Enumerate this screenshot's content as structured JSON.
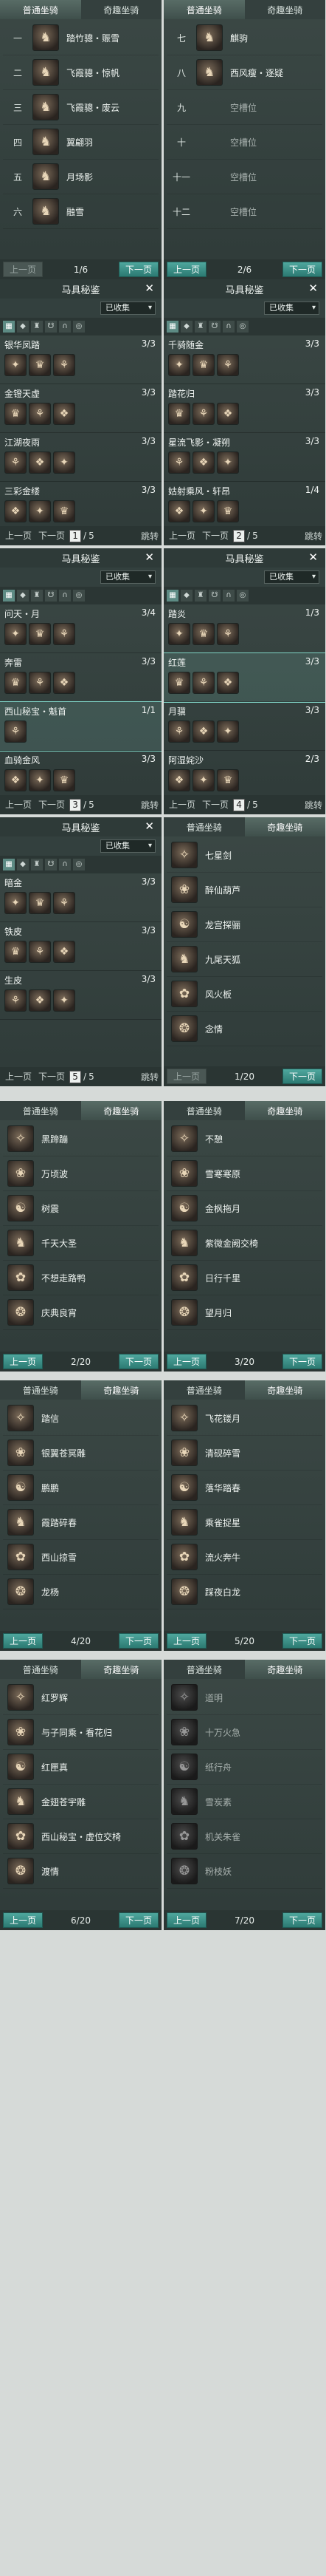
{
  "common": {
    "tab_normal": "普通坐骑",
    "tab_special": "奇趣坐骑",
    "prev": "上一页",
    "next": "下一页",
    "gear_title": "马具秘鉴",
    "filter_value": "已收集",
    "jump": "跳转",
    "icon_color_accent": "#7fd4c6"
  },
  "p1": {
    "page": "1/6",
    "rows": [
      {
        "idx": "一",
        "name": "踏竹骢・赈雪",
        "icon": "horse-icon"
      },
      {
        "idx": "二",
        "name": "飞霞骢・惊帆",
        "icon": "horse-icon"
      },
      {
        "idx": "三",
        "name": "飞霞骢・废云",
        "icon": "horse-icon"
      },
      {
        "idx": "四",
        "name": "翼翩羽",
        "icon": "horse-icon"
      },
      {
        "idx": "五",
        "name": "月场影",
        "icon": "horse-icon"
      },
      {
        "idx": "六",
        "name": "融雪",
        "icon": "horse-icon"
      }
    ]
  },
  "p2": {
    "page": "2/6",
    "rows": [
      {
        "idx": "七",
        "name": "麒驹",
        "icon": "horse-icon"
      },
      {
        "idx": "八",
        "name": "西风瘦・逐疑",
        "icon": "horse-icon"
      },
      {
        "idx": "九",
        "name": "空槽位",
        "icon": ""
      },
      {
        "idx": "十",
        "name": "空槽位",
        "icon": ""
      },
      {
        "idx": "十一",
        "name": "空槽位",
        "icon": ""
      },
      {
        "idx": "十二",
        "name": "空槽位",
        "icon": ""
      }
    ]
  },
  "g1": {
    "page_box": "1",
    "page_total": "5",
    "sets": [
      {
        "name": "银华凤踏",
        "count": "3/3"
      },
      {
        "name": "金镫天虚",
        "count": "3/3"
      },
      {
        "name": "江湖夜雨",
        "count": "3/3"
      },
      {
        "name": "三彩金缕",
        "count": "3/3"
      }
    ]
  },
  "g2": {
    "page_box": "2",
    "page_total": "5",
    "sets": [
      {
        "name": "千骑随金",
        "count": "3/3"
      },
      {
        "name": "踏花归",
        "count": "3/3"
      },
      {
        "name": "星流飞影・凝朔",
        "count": "3/3"
      },
      {
        "name": "姑射乘风・轩昂",
        "count": "1/4"
      }
    ]
  },
  "g3": {
    "page_box": "3",
    "page_total": "5",
    "sets": [
      {
        "name": "问天・月",
        "count": "3/4"
      },
      {
        "name": "奔雷",
        "count": "3/3"
      },
      {
        "name": "西山秘宝・魁首",
        "count": "1/1"
      },
      {
        "name": "血骑金风",
        "count": "3/3"
      }
    ]
  },
  "g4": {
    "page_box": "4",
    "page_total": "5",
    "sets": [
      {
        "name": "踏炎",
        "count": "1/3"
      },
      {
        "name": "红莲",
        "count": "3/3"
      },
      {
        "name": "月骥",
        "count": "3/3"
      },
      {
        "name": "阿湿姹沙",
        "count": "2/3"
      }
    ]
  },
  "g5": {
    "page_box": "5",
    "page_total": "5",
    "sets": [
      {
        "name": "暗金",
        "count": "3/3"
      },
      {
        "name": "铁皮",
        "count": "3/3"
      },
      {
        "name": "生皮",
        "count": "3/3"
      }
    ]
  },
  "s1": {
    "page": "1/20",
    "rows": [
      {
        "name": "七星剑"
      },
      {
        "name": "醉仙葫芦"
      },
      {
        "name": "龙宫探骊"
      },
      {
        "name": "九尾天狐"
      },
      {
        "name": "风火板"
      },
      {
        "name": "念情"
      }
    ]
  },
  "s2": {
    "page": "2/20",
    "rows": [
      {
        "name": "黑蹄蹦"
      },
      {
        "name": "万顷波"
      },
      {
        "name": "树震"
      },
      {
        "name": "千天大圣"
      },
      {
        "name": "不想走路鸭"
      },
      {
        "name": "庆典良宵"
      }
    ]
  },
  "s3": {
    "page": "3/20",
    "rows": [
      {
        "name": "不憩"
      },
      {
        "name": "雪寒寒原"
      },
      {
        "name": "金枫拖月"
      },
      {
        "name": "紫微金阙交椅"
      },
      {
        "name": "日行千里"
      },
      {
        "name": "望月归"
      }
    ]
  },
  "s4": {
    "page": "4/20",
    "rows": [
      {
        "name": "踏信"
      },
      {
        "name": "银翼苍冥雕"
      },
      {
        "name": "鹏鹏"
      },
      {
        "name": "霞踏碎春"
      },
      {
        "name": "西山掠雪"
      },
      {
        "name": "龙杨"
      }
    ]
  },
  "s5": {
    "page": "5/20",
    "rows": [
      {
        "name": "飞花镂月"
      },
      {
        "name": "清砚碎雪"
      },
      {
        "name": "落华踏春"
      },
      {
        "name": "乘雀捉星"
      },
      {
        "name": "流火奔牛"
      },
      {
        "name": "踩夜白龙"
      }
    ]
  },
  "s6": {
    "page": "6/20",
    "rows": [
      {
        "name": "红罗辉"
      },
      {
        "name": "与子同乘・看花归"
      },
      {
        "name": "红匣真"
      },
      {
        "name": "金翅苍宇雕"
      },
      {
        "name": "西山秘宝・虚位交椅"
      },
      {
        "name": "渡情"
      }
    ]
  },
  "s7": {
    "page": "7/20",
    "rows": [
      {
        "name": "道明"
      },
      {
        "name": "十万火急"
      },
      {
        "name": "纸行舟"
      },
      {
        "name": "雪炭素"
      },
      {
        "name": "机关朱雀"
      },
      {
        "name": "粉枝妖"
      }
    ]
  }
}
